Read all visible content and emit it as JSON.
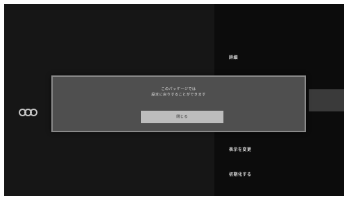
{
  "menu": {
    "detail_label": "詳細",
    "change_order_label": "表示を変更",
    "initialize_label": "初期化する"
  },
  "dialog": {
    "message_line1": "このパッケージでは",
    "message_line2": "設定に戻りすることができます",
    "button_label": "閉じる"
  },
  "icons": {
    "circle_group": "circle-icons"
  }
}
